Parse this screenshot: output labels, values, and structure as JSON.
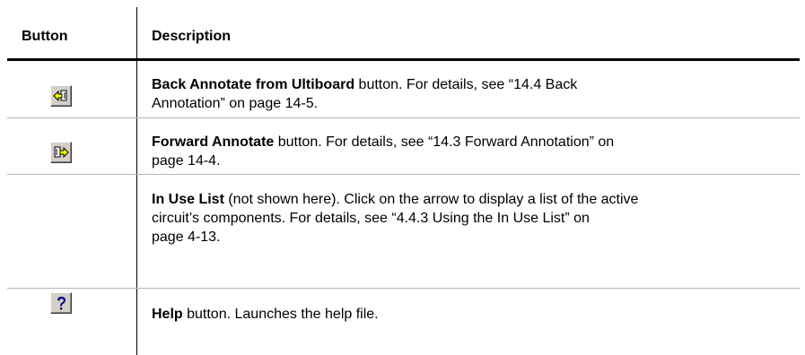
{
  "table": {
    "headers": {
      "button": "Button",
      "description": "Description"
    },
    "rows": [
      {
        "icon": "back-annotate-icon",
        "bold": "Back Annotate from Ultiboard",
        "text_lines": [
          " button. For details, see “14.4 Back",
          "Annotation” on page 14-5."
        ]
      },
      {
        "icon": "forward-annotate-icon",
        "bold": "Forward Annotate",
        "text_lines": [
          " button. For details, see “14.3 Forward Annotation” on",
          "page 14-4."
        ]
      },
      {
        "icon": "",
        "bold": "In Use List",
        "text_lines": [
          " (not shown here). Click on the arrow to display a list of the active",
          "circuit’s components. For details, see “4.4.3 Using the In Use List” on",
          "page 4-13."
        ]
      },
      {
        "icon": "help-icon",
        "bold": "Help",
        "text_lines": [
          " button. Launches the help file."
        ]
      }
    ]
  }
}
